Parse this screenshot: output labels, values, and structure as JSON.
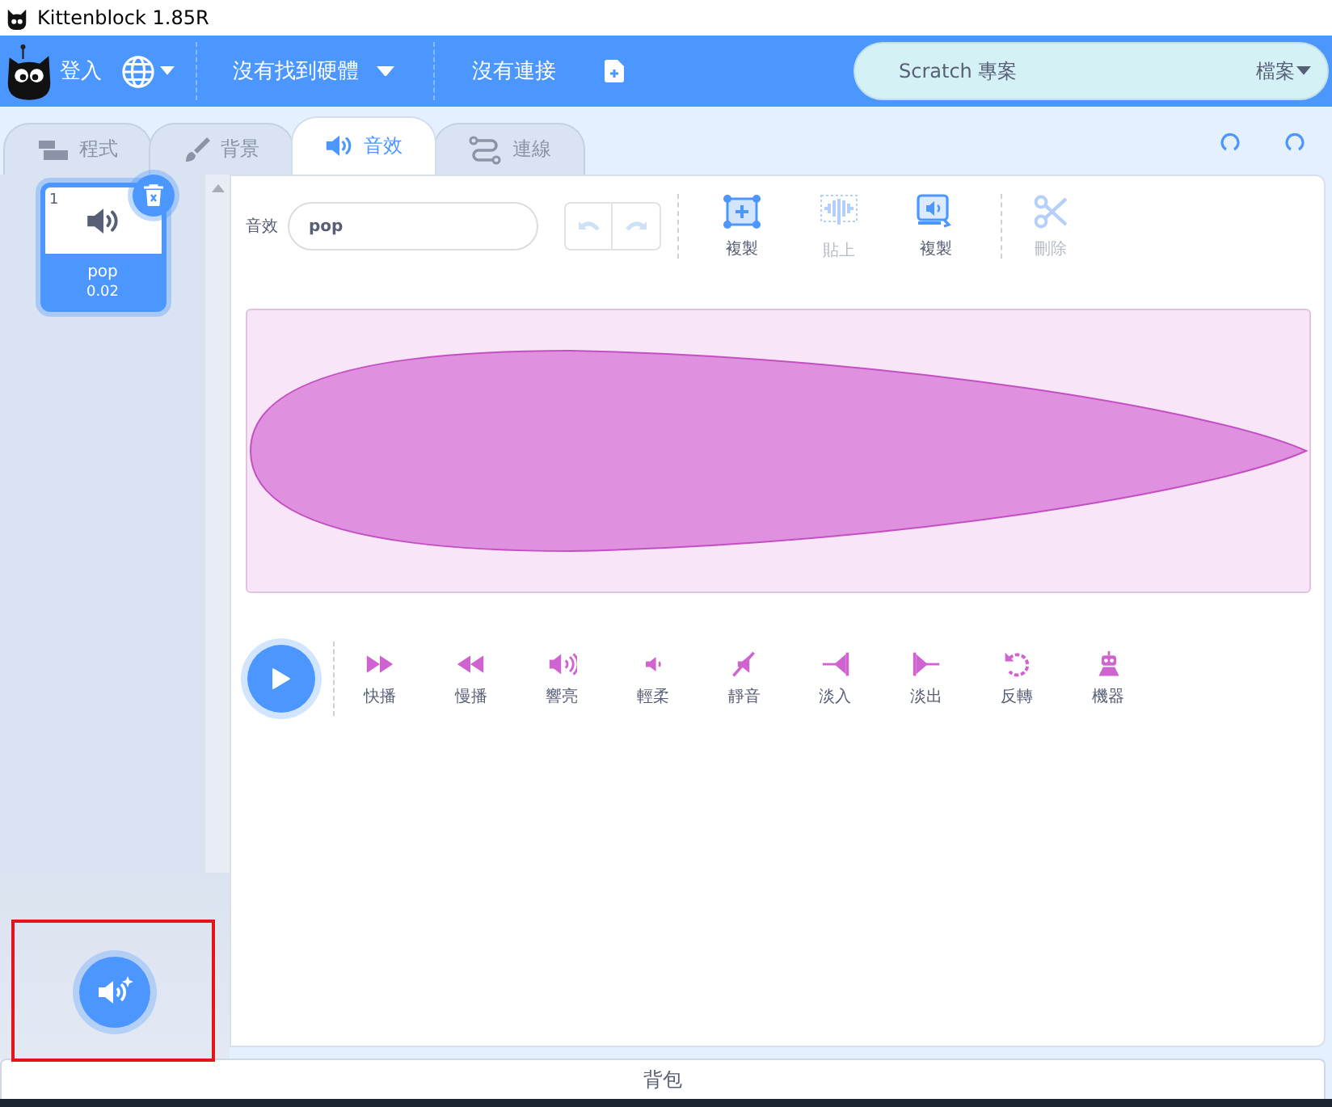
{
  "window": {
    "title": "Kittenblock 1.85R"
  },
  "menu_bar": {
    "login": "登入",
    "hardware": "沒有找到硬體",
    "connection": "沒有連接",
    "project_title": "Scratch 專案",
    "file_menu": "檔案"
  },
  "tabs": [
    {
      "kind": "code",
      "label": "程式",
      "selected": false
    },
    {
      "kind": "backdrop",
      "label": "背景",
      "selected": false
    },
    {
      "kind": "sound",
      "label": "音效",
      "selected": true
    },
    {
      "kind": "link",
      "label": "連線",
      "selected": false
    }
  ],
  "sounds": [
    {
      "number": "1",
      "name": "pop",
      "duration": "0.02",
      "selected": true
    }
  ],
  "editor": {
    "name_label": "音效",
    "name_value": "pop",
    "undo": {
      "disabled": true
    },
    "redo": {
      "disabled": true
    },
    "tools": [
      {
        "kind": "copy",
        "label": "複製",
        "disabled": false
      },
      {
        "kind": "paste",
        "label": "貼上",
        "disabled": true
      },
      {
        "kind": "copy_to_new",
        "label": "複製",
        "disabled": false
      },
      {
        "kind": "delete",
        "label": "刪除",
        "disabled": true
      }
    ],
    "effects": [
      {
        "kind": "faster",
        "label": "快播"
      },
      {
        "kind": "slower",
        "label": "慢播"
      },
      {
        "kind": "louder",
        "label": "響亮"
      },
      {
        "kind": "softer",
        "label": "輕柔"
      },
      {
        "kind": "mute",
        "label": "靜音"
      },
      {
        "kind": "fade_in",
        "label": "淡入"
      },
      {
        "kind": "fade_out",
        "label": "淡出"
      },
      {
        "kind": "reverse",
        "label": "反轉"
      },
      {
        "kind": "robot",
        "label": "機器"
      }
    ]
  },
  "backpack": {
    "label": "背包"
  }
}
